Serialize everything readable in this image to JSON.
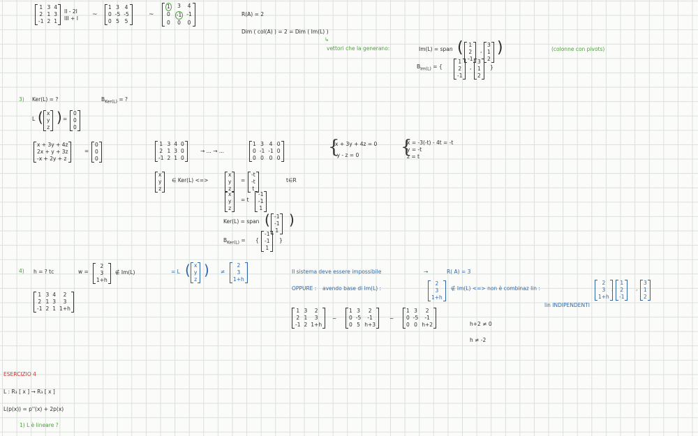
{
  "top": {
    "m1": [
      "1",
      "3",
      "4",
      "2",
      "1",
      "3",
      "-1",
      "2",
      "1"
    ],
    "ops": [
      "II - 2I",
      "III + I"
    ],
    "tilde": "~",
    "m2": [
      "1",
      "3",
      "4",
      "0",
      "-5",
      "-5",
      "0",
      "5",
      "5"
    ],
    "m3": [
      "1",
      "3",
      "4",
      "0",
      "-1",
      "-1",
      "0",
      "0",
      "0"
    ],
    "rank": "R(A) = 2",
    "dim": "Dim ( col(A) ) = 2 = Dim ( Im(L) )",
    "vettori": "vettori che la generano:",
    "im_span": "Im(L) = span",
    "v1": [
      "1",
      "2",
      "-1"
    ],
    "v2": [
      "3",
      "1",
      "2"
    ],
    "colonne_pivots": "(colonne con pivots)",
    "base_im": "B",
    "base_im_sub": "Im(L)",
    "equals_open": "= {",
    "close_brace": "}"
  },
  "s3": {
    "num": "3)",
    "ker_q": "Ker(L) = ?",
    "base_ker_q": "B",
    "base_ker_q_sub": "Ker(L)",
    "base_ker_q_tail": "= ?",
    "L_of": "L",
    "xyz": [
      "x",
      "y",
      "z"
    ],
    "zeros": [
      "0",
      "0",
      "0"
    ],
    "sys": [
      "x + 3y + 4z",
      "2x + y + 3z",
      "-x + 2y + z"
    ],
    "aug1": [
      "1",
      "3",
      "4",
      "0",
      "2",
      "1",
      "3",
      "0",
      "-1",
      "2",
      "1",
      "0"
    ],
    "arrow_dots1": "→ ... → ...",
    "aug2": [
      "1",
      "3",
      "4",
      "0",
      "0",
      "-1",
      "-1",
      "0",
      "0",
      "0",
      "0",
      "0"
    ],
    "eqs": [
      "x + 3y + 4z = 0",
      "-y - z = 0"
    ],
    "sol": [
      "x = -3(-t) - 4t = -t",
      "y = -t",
      "z = t"
    ],
    "in_ker": "∈ Ker(L)  <=>",
    "param": [
      "-t",
      "-t",
      "t"
    ],
    "t_in_R": "t∈R",
    "eq_t": "= t",
    "vec_ker": [
      "-1",
      "-1",
      "1"
    ],
    "ker_span": "Ker(L) = span",
    "base_ker": "B",
    "base_ker_sub": "Ker(L)",
    "base_ker_eq": "="
  },
  "s4": {
    "num": "4)",
    "h_q": "h = ?   tc",
    "w": "w =",
    "w_vec": [
      "2",
      "3",
      "1+h"
    ],
    "notin": "∉  Im(L)",
    "eq_L": "= L",
    "neq": "≠",
    "aug": [
      "1",
      "3",
      "4",
      "2",
      "2",
      "1",
      "3",
      "3",
      "-1",
      "2",
      "1",
      "1+h"
    ],
    "impossibile": "Il sistema deve essere impossibile",
    "arrow": "→",
    "rA3": "R( A) = 3",
    "oppure": "OPPURE :",
    "avendo": "avendo base di Im(L) :",
    "non_comb": "∉ Im(L)  <=>  non è combinaz lin :",
    "lin_indip": "lin INDIPENDENTI",
    "r1": [
      "1",
      "3",
      "2",
      "2",
      "1",
      "3",
      "-1",
      "2",
      "1+h"
    ],
    "r2": [
      "1",
      "3",
      "2",
      "0",
      "-5",
      "-1",
      "0",
      "5",
      "h+3"
    ],
    "r3": [
      "1",
      "3",
      "2",
      "0",
      "-5",
      "-1",
      "0",
      "0",
      "h+2"
    ],
    "h2": "h+2 ≠ 0",
    "h3": "h ≠ -2"
  },
  "es4": {
    "title": "ESERCIZIO 4",
    "map": "L : R₃ [ x ] → R₃ [ x ]",
    "def": "L(p(x))  =  p''(x) + 2p(x)",
    "q1": "1)  L è lineare ?"
  }
}
